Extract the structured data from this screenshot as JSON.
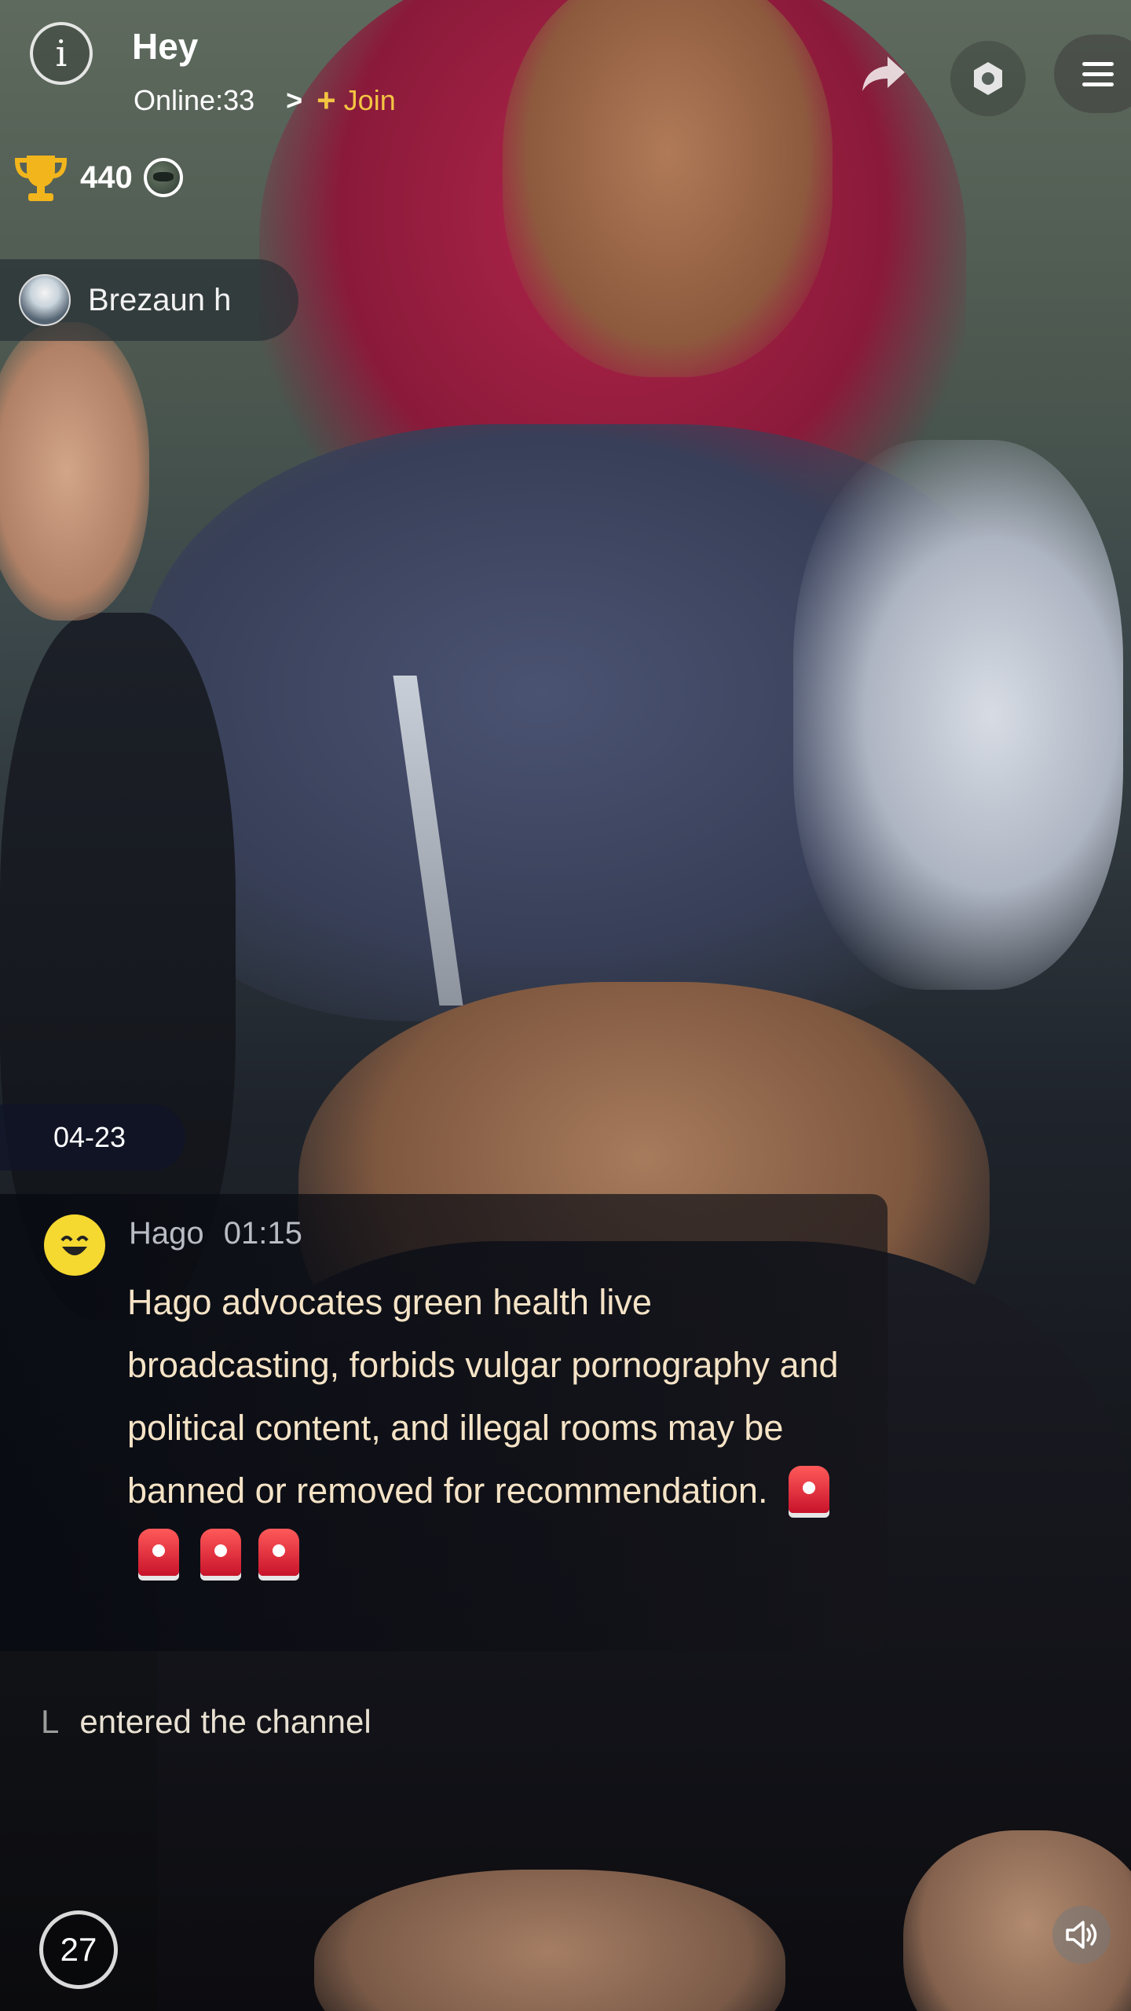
{
  "header": {
    "title": "Hey",
    "online_label": "Online:33",
    "chevron": ">",
    "join_label": "Join"
  },
  "stats": {
    "score": "440"
  },
  "user": {
    "name": "Brezaun h"
  },
  "chat": {
    "date": "04-23",
    "system_message": {
      "sender": "Hago",
      "time": "01:15",
      "text": "Hago advocates green health live broadcasting, forbids vulgar pornography and political content, and illegal rooms may be banned or removed for recommendation."
    },
    "join_event": {
      "user": "L",
      "text": "entered the channel"
    }
  },
  "footer": {
    "timer_value": "27"
  },
  "icons": {
    "info": "info-icon",
    "share": "share-icon",
    "settings": "settings-gear-icon",
    "menu": "hamburger-menu-icon",
    "trophy": "trophy-icon",
    "globe": "globe-icon",
    "siren": "siren-emoji-icon",
    "smiley": "hago-smiley-icon",
    "sound": "speaker-icon"
  },
  "colors": {
    "join": "#f4c542",
    "system_text": "#f5e3c6",
    "hago_yellow": "#f5d830",
    "siren_red": "#e0223a"
  }
}
